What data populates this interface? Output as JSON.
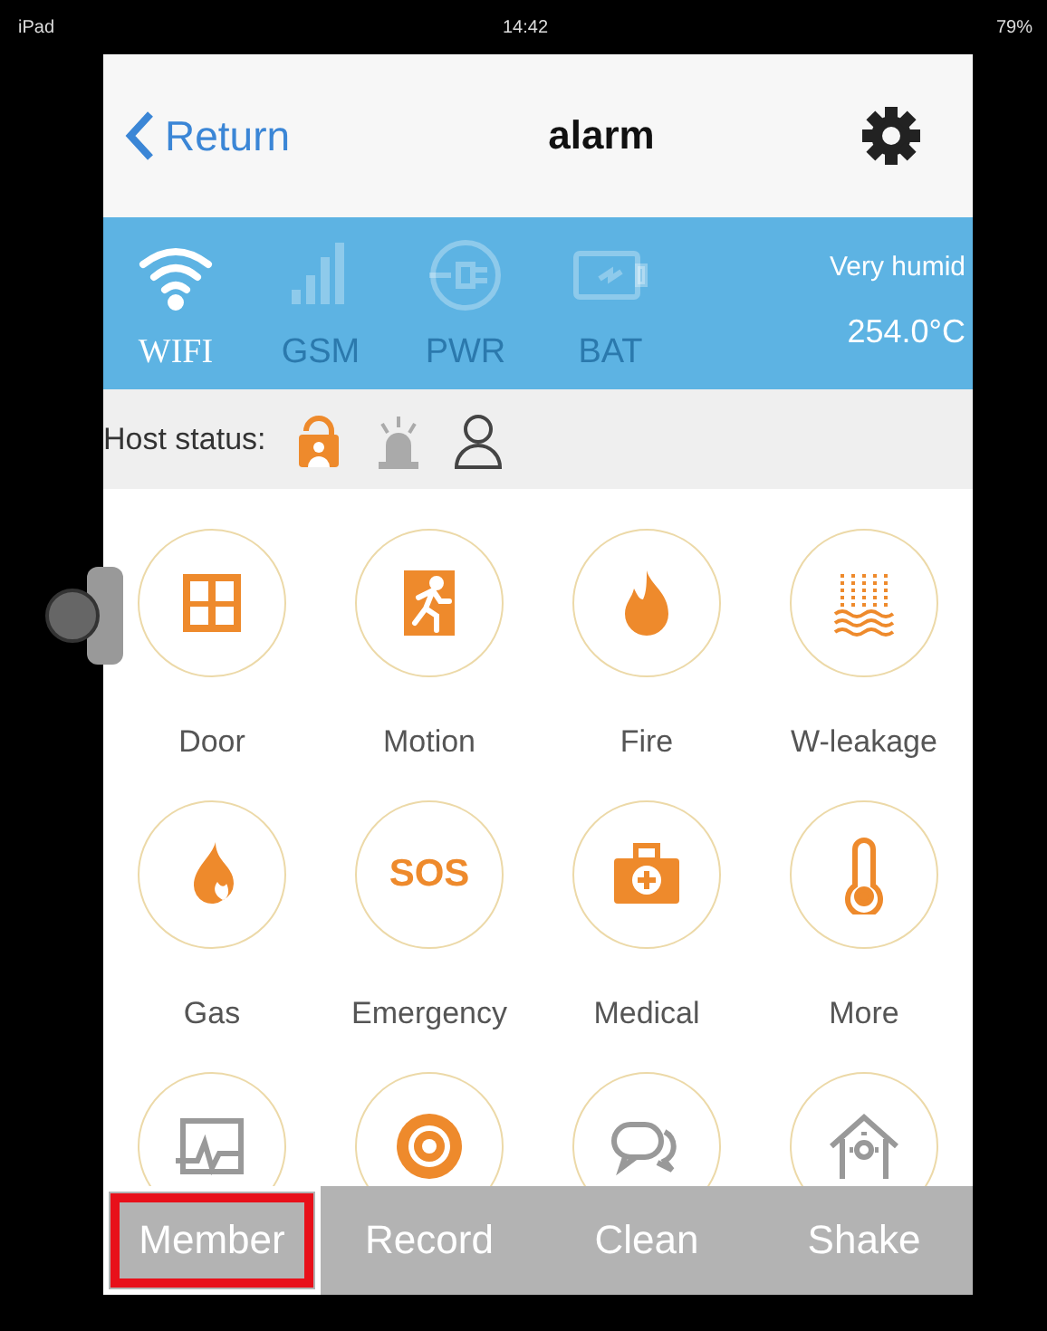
{
  "status_bar": {
    "device": "iPad",
    "time": "14:42",
    "battery": "79%"
  },
  "nav": {
    "back": "Return",
    "title": "alarm"
  },
  "signals": [
    {
      "label": "WIFI",
      "active": true
    },
    {
      "label": "GSM",
      "active": false
    },
    {
      "label": "PWR",
      "active": false
    },
    {
      "label": "BAT",
      "active": false
    }
  ],
  "climate": {
    "humidity": "Very humid",
    "temperature": "254.0°C"
  },
  "host_status": {
    "label": "Host status:"
  },
  "sensors": [
    {
      "label": "Door"
    },
    {
      "label": "Motion"
    },
    {
      "label": "Fire"
    },
    {
      "label": "W-leakage"
    },
    {
      "label": "Gas"
    },
    {
      "label": "Emergency",
      "icon_text": "SOS"
    },
    {
      "label": "Medical"
    },
    {
      "label": "More"
    }
  ],
  "bottom_tabs": [
    {
      "label": "Member",
      "highlighted": true
    },
    {
      "label": "Record",
      "highlighted": false
    },
    {
      "label": "Clean",
      "highlighted": false
    },
    {
      "label": "Shake",
      "highlighted": false
    }
  ]
}
